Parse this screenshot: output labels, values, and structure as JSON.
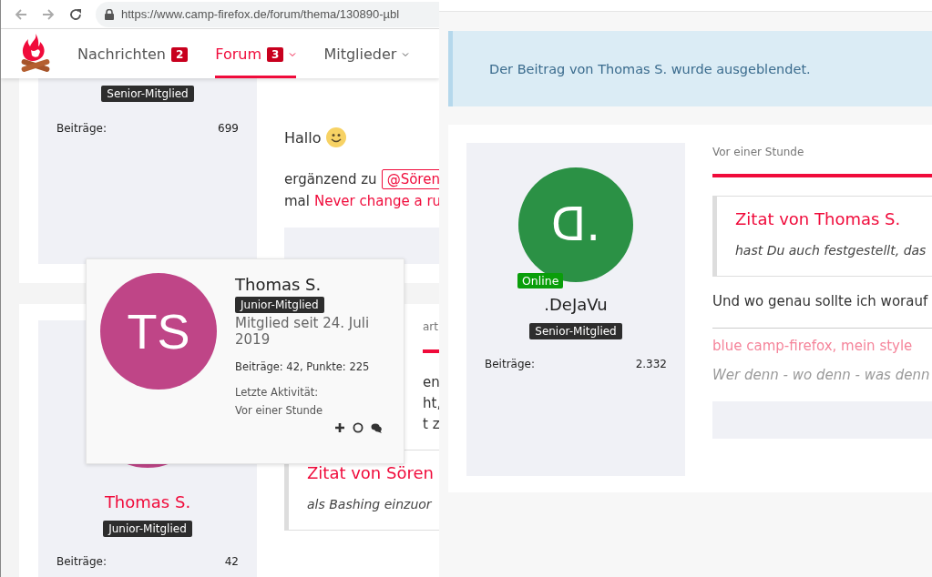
{
  "browser": {
    "url": "https://www.camp-firefox.de/forum/thema/130890-µbl"
  },
  "nav": [
    {
      "label": "Nachrichten",
      "badge": "2",
      "dropdown": false,
      "selected": false
    },
    {
      "label": "Forum",
      "badge": "3",
      "dropdown": true,
      "selected": true
    },
    {
      "label": "Mitglieder",
      "dropdown": true,
      "selected": false
    }
  ],
  "left_posts": [
    {
      "rank": "Senior-Mitglied",
      "stat_label": "Beiträge:",
      "stat_value": "699",
      "body": [
        {
          "kind": "emoji",
          "text": "Hallo"
        },
        {
          "kind": "mention",
          "text": "ergänzend zu",
          "mention": "@Sören"
        },
        {
          "kind": "link",
          "text": "mal",
          "link": "Never change a ru"
        }
      ]
    },
    {
      "name": "Thomas S.",
      "rank": "Junior-Mitglied",
      "stat_label": "Beiträge:",
      "stat_value": "42",
      "fragments": [
        "art",
        "en",
        "ht,",
        "t z"
      ],
      "quote_title": "Zitat von Sören",
      "quote_text": "als Bashing einzuor"
    }
  ],
  "hover_card": {
    "initials": "TS",
    "color": "#bf4587",
    "name": "Thomas S.",
    "rank": "Junior-Mitglied",
    "since": "Mitglied seit 24. Juli 2019",
    "stats": "Beiträge: 42, Punkte: 225",
    "activity_label": "Letzte Aktivität:",
    "activity": "Vor einer Stunde"
  },
  "notice": "Der Beitrag von Thomas S. wurde ausgeblendet.",
  "right_post": {
    "initials": "ᗡ.",
    "color": "#2b9145",
    "online": true,
    "online_label": "Online",
    "name": ".DeJaVu",
    "rank": "Senior-Mitglied",
    "stat_label": "Beiträge:",
    "stat_value": "2.332",
    "time": "Vor einer Stunde",
    "quote_title": "Zitat von Thomas S.",
    "quote_text": "hast Du auch festgestellt, das",
    "text": "Und wo genau sollte ich worauf",
    "signature": "blue camp-firefox, mein style",
    "signature_quote": "Wer denn - wo denn - was denn"
  }
}
